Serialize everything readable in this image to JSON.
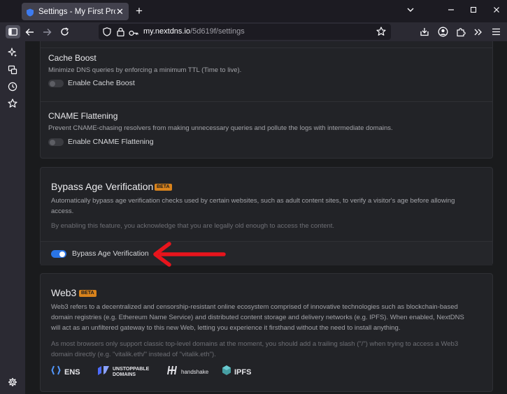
{
  "browser": {
    "tab_title": "Settings - My First Profile - NextDNS",
    "url_host": "my.nextdns.io",
    "url_path": "/5d619f/settings"
  },
  "settings": {
    "cache_boost": {
      "title": "Cache Boost",
      "description": "Minimize DNS queries by enforcing a minimum TTL (Time to live).",
      "toggle_label": "Enable Cache Boost",
      "enabled": false
    },
    "cname_flattening": {
      "title": "CNAME Flattening",
      "description": "Prevent CNAME-chasing resolvers from making unnecessary queries and pollute the logs with intermediate domains.",
      "toggle_label": "Enable CNAME Flattening",
      "enabled": false
    }
  },
  "bypass_age": {
    "title": "Bypass Age Verification",
    "badge": "BETA",
    "description_line1": "Automatically bypass age verification checks used by certain websites, such as adult content sites, to verify a visitor's age before allowing",
    "description_line2": "access.",
    "note": "By enabling this feature, you acknowledge that you are legally old enough to access the content.",
    "toggle_label": "Bypass Age Verification",
    "enabled": true
  },
  "web3": {
    "title": "Web3",
    "badge": "BETA",
    "description_line1": "Web3 refers to a decentralized and censorship-resistant online ecosystem comprised of innovative technologies such as blockchain-based",
    "description_line2": "domain registries (e.g. Ethereum Name Service) and distributed content storage and delivery networks (e.g. IPFS). When enabled, NextDNS",
    "description_line3": "will act as an unfiltered gateway to this new Web, letting you experience it firsthand without the need to install anything.",
    "note_line1": "As most browsers only support classic top-level domains at the moment, you should add a trailing slash (\"/\") when trying to access a Web3",
    "note_line2": "domain directly (e.g. \"vitalik.eth/\" instead of \"vitalik.eth\").",
    "logos": {
      "ens": "ENS",
      "unstoppable_line1": "UNSTOPPABLE",
      "unstoppable_line2": "DOMAINS",
      "handshake": "handshake",
      "ipfs": "IPFS"
    }
  },
  "colors": {
    "accent": "#2a75e6",
    "beta": "#d9831c",
    "annotation_arrow": "#e8141c"
  }
}
